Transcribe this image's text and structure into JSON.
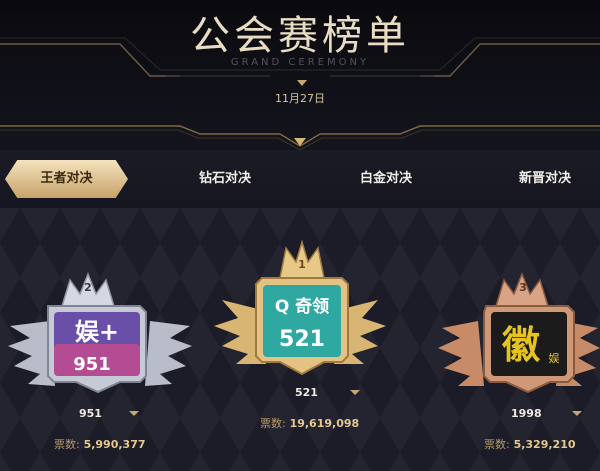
{
  "header": {
    "title": "公会赛榜单",
    "subtitle": "GRAND CEREMONY",
    "date": "11月27日"
  },
  "tabs": [
    {
      "label": "王者对决",
      "active": true
    },
    {
      "label": "钻石对决",
      "active": false
    },
    {
      "label": "白金对决",
      "active": false
    },
    {
      "label": "新晋对决",
      "active": false
    }
  ],
  "ranking": {
    "votes_label": "票数:",
    "entries": [
      {
        "rank": "2",
        "name": "951",
        "votes": "5,990,377",
        "logo_text": "娱+ 951",
        "frame": "silver"
      },
      {
        "rank": "1",
        "name": "521",
        "votes": "19,619,098",
        "logo_text": "奇领 521",
        "frame": "gold"
      },
      {
        "rank": "3",
        "name": "1998",
        "votes": "5,329,210",
        "logo_text": "徽 娱",
        "frame": "bronze"
      }
    ]
  },
  "colors": {
    "gold": "#d8b572",
    "silver": "#c9ccd6",
    "bronze": "#c98c6a",
    "accent_text": "#e6c98e"
  }
}
